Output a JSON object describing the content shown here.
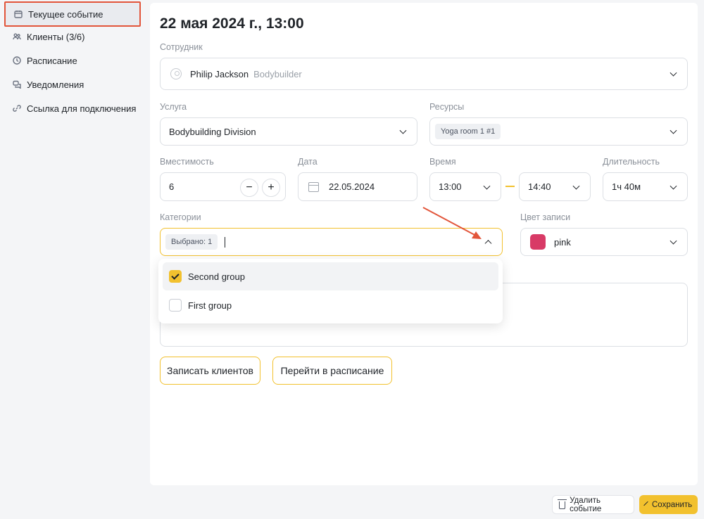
{
  "sidebar": {
    "items": [
      {
        "label": "Текущее событие",
        "icon": "calendar-icon",
        "active": true
      },
      {
        "label": "Клиенты (3/6)",
        "icon": "users-icon"
      },
      {
        "label": "Расписание",
        "icon": "clock-icon"
      },
      {
        "label": "Уведомления",
        "icon": "chat-icon"
      },
      {
        "label": "Ссылка для подключения",
        "icon": "link-icon"
      }
    ]
  },
  "event": {
    "title": "22 мая 2024 г., 13:00",
    "employee": {
      "label": "Сотрудник",
      "name": "Philip Jackson",
      "role": "Bodybuilder"
    },
    "service": {
      "label": "Услуга",
      "value": "Bodybuilding Division"
    },
    "resources": {
      "label": "Ресурсы",
      "tag": "Yoga room 1 #1"
    },
    "capacity": {
      "label": "Вместимость",
      "value": "6",
      "minus": "−",
      "plus": "+"
    },
    "date": {
      "label": "Дата",
      "value": "22.05.2024"
    },
    "time": {
      "label": "Время",
      "start": "13:00",
      "end": "14:40"
    },
    "duration": {
      "label": "Длительность",
      "value": "1ч 40м"
    },
    "categories": {
      "label": "Категории",
      "selected_badge": "Выбрано: 1",
      "options": [
        {
          "label": "Second group",
          "checked": true
        },
        {
          "label": "First group",
          "checked": false
        }
      ]
    },
    "color": {
      "label": "Цвет записи",
      "value": "pink",
      "hex": "#d83a66"
    }
  },
  "actions": {
    "enroll": "Записать клиентов",
    "go_schedule": "Перейти в расписание"
  },
  "footer": {
    "delete": "Удалить событие",
    "save": "Сохранить"
  },
  "colors": {
    "accent": "#f2c12e",
    "highlight": "#e2553a"
  }
}
